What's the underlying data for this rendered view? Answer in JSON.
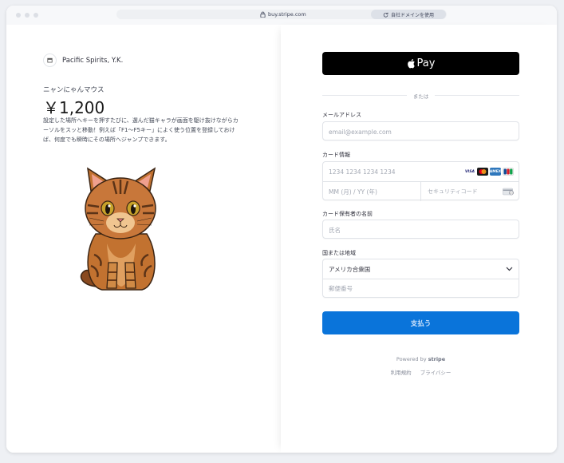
{
  "browser": {
    "url": "buy.stripe.com",
    "domain_pill": "自社ドメインを使用"
  },
  "merchant": {
    "name": "Pacific Spirits, Y.K."
  },
  "product": {
    "name": "ニャンにゃんマウス",
    "price": "￥1,200",
    "description": "設定した場所へキーを押すたびに、選んだ猫キャラが画面を駆け抜けながらカーソルをスッと移動！例えば「F1～F5キー」によく使う位置を登録しておけば、何度でも瞬時にその場所へジャンプできます。"
  },
  "payment": {
    "applepay_label": "Pay",
    "divider_text": "または",
    "email": {
      "label": "メールアドレス",
      "placeholder": "email@example.com",
      "value": ""
    },
    "card": {
      "label": "カード情報",
      "number_placeholder": "1234 1234 1234 1234",
      "expiry_placeholder": "MM (月) / YY (年)",
      "cvc_placeholder": "セキュリティコード",
      "brands": [
        "VISA",
        "MC",
        "AMEX",
        "JCB"
      ]
    },
    "cardholder": {
      "label": "カード保有者の名前",
      "placeholder": "氏名",
      "value": ""
    },
    "country": {
      "label": "国または地域",
      "selected": "アメリカ合衆国",
      "zip_placeholder": "郵便番号"
    },
    "pay_button": "支払う"
  },
  "footer": {
    "powered_prefix": "Powered by",
    "powered_brand": "stripe",
    "terms": "利用規約",
    "privacy": "プライバシー"
  },
  "colors": {
    "pay_button": "#0a74da",
    "applepay_bg": "#000000"
  },
  "icons": [
    "lock-icon",
    "refresh-icon",
    "store-icon",
    "apple-icon",
    "chevron-down-icon",
    "cvc-card-icon"
  ]
}
